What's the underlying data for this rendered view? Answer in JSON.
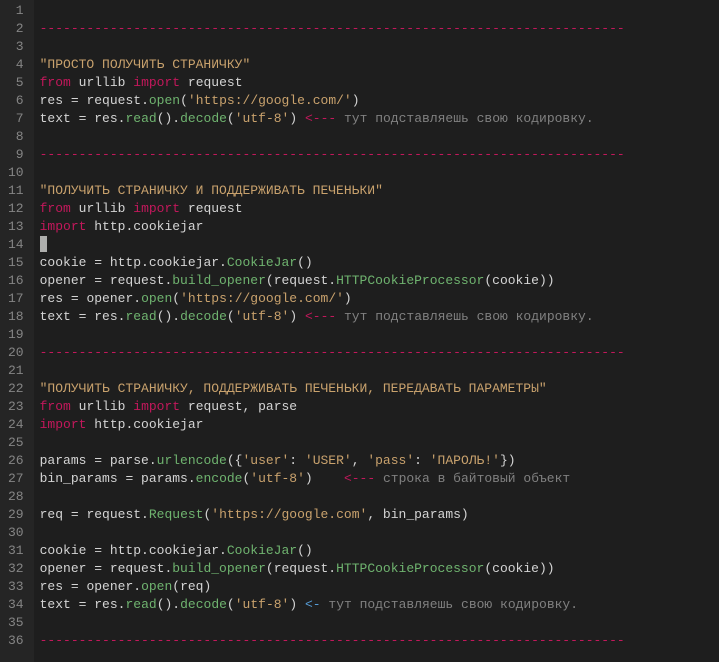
{
  "lines": [
    {
      "n": 1,
      "tokens": []
    },
    {
      "n": 2,
      "tokens": [
        {
          "c": "tok-comment-dash",
          "t": "---------------------------------------------------------------------------"
        }
      ]
    },
    {
      "n": 3,
      "tokens": []
    },
    {
      "n": 4,
      "tokens": [
        {
          "c": "tok-string",
          "t": "\"ПРОСТО ПОЛУЧИТЬ СТРАНИЧКУ\""
        }
      ]
    },
    {
      "n": 5,
      "tokens": [
        {
          "c": "tok-keyword",
          "t": "from"
        },
        {
          "c": "",
          "t": " "
        },
        {
          "c": "tok-module",
          "t": "urllib"
        },
        {
          "c": "",
          "t": " "
        },
        {
          "c": "tok-keyword",
          "t": "import"
        },
        {
          "c": "",
          "t": " "
        },
        {
          "c": "tok-module",
          "t": "request"
        }
      ]
    },
    {
      "n": 6,
      "tokens": [
        {
          "c": "tok-var",
          "t": "res "
        },
        {
          "c": "tok-op",
          "t": "="
        },
        {
          "c": "tok-var",
          "t": " request"
        },
        {
          "c": "tok-op",
          "t": "."
        },
        {
          "c": "tok-func",
          "t": "open"
        },
        {
          "c": "tok-paren",
          "t": "("
        },
        {
          "c": "tok-string",
          "t": "'https://google.com/'"
        },
        {
          "c": "tok-paren",
          "t": ")"
        }
      ]
    },
    {
      "n": 7,
      "tokens": [
        {
          "c": "tok-var",
          "t": "text "
        },
        {
          "c": "tok-op",
          "t": "="
        },
        {
          "c": "tok-var",
          "t": " res"
        },
        {
          "c": "tok-op",
          "t": "."
        },
        {
          "c": "tok-func",
          "t": "read"
        },
        {
          "c": "tok-paren",
          "t": "()"
        },
        {
          "c": "tok-op",
          "t": "."
        },
        {
          "c": "tok-func",
          "t": "decode"
        },
        {
          "c": "tok-paren",
          "t": "("
        },
        {
          "c": "tok-string",
          "t": "'utf-8'"
        },
        {
          "c": "tok-paren",
          "t": ")"
        },
        {
          "c": "",
          "t": " "
        },
        {
          "c": "tok-arrow",
          "t": "<---"
        },
        {
          "c": "",
          "t": " "
        },
        {
          "c": "tok-rucomment",
          "t": "тут подставляешь свою кодировку."
        }
      ]
    },
    {
      "n": 8,
      "tokens": []
    },
    {
      "n": 9,
      "tokens": [
        {
          "c": "tok-comment-dash",
          "t": "---------------------------------------------------------------------------"
        }
      ]
    },
    {
      "n": 10,
      "tokens": []
    },
    {
      "n": 11,
      "tokens": [
        {
          "c": "tok-string",
          "t": "\"ПОЛУЧИТЬ СТРАНИЧКУ И ПОДДЕРЖИВАТЬ ПЕЧЕНЬКИ\""
        }
      ]
    },
    {
      "n": 12,
      "tokens": [
        {
          "c": "tok-keyword",
          "t": "from"
        },
        {
          "c": "",
          "t": " "
        },
        {
          "c": "tok-module",
          "t": "urllib"
        },
        {
          "c": "",
          "t": " "
        },
        {
          "c": "tok-keyword",
          "t": "import"
        },
        {
          "c": "",
          "t": " "
        },
        {
          "c": "tok-module",
          "t": "request"
        }
      ]
    },
    {
      "n": 13,
      "tokens": [
        {
          "c": "tok-keyword",
          "t": "import"
        },
        {
          "c": "",
          "t": " "
        },
        {
          "c": "tok-module",
          "t": "http.cookiejar"
        }
      ]
    },
    {
      "n": 14,
      "tokens": [
        {
          "c": "tok-cursor",
          "t": " "
        }
      ]
    },
    {
      "n": 15,
      "tokens": [
        {
          "c": "tok-var",
          "t": "cookie "
        },
        {
          "c": "tok-op",
          "t": "="
        },
        {
          "c": "tok-var",
          "t": " http.cookiejar."
        },
        {
          "c": "tok-func",
          "t": "CookieJar"
        },
        {
          "c": "tok-paren",
          "t": "()"
        }
      ]
    },
    {
      "n": 16,
      "tokens": [
        {
          "c": "tok-var",
          "t": "opener "
        },
        {
          "c": "tok-op",
          "t": "="
        },
        {
          "c": "tok-var",
          "t": " request."
        },
        {
          "c": "tok-func",
          "t": "build_opener"
        },
        {
          "c": "tok-paren",
          "t": "("
        },
        {
          "c": "tok-var",
          "t": "request."
        },
        {
          "c": "tok-func",
          "t": "HTTPCookieProcessor"
        },
        {
          "c": "tok-paren",
          "t": "("
        },
        {
          "c": "tok-var",
          "t": "cookie"
        },
        {
          "c": "tok-paren",
          "t": "))"
        }
      ]
    },
    {
      "n": 17,
      "tokens": [
        {
          "c": "tok-var",
          "t": "res "
        },
        {
          "c": "tok-op",
          "t": "="
        },
        {
          "c": "tok-var",
          "t": " opener"
        },
        {
          "c": "tok-op",
          "t": "."
        },
        {
          "c": "tok-func",
          "t": "open"
        },
        {
          "c": "tok-paren",
          "t": "("
        },
        {
          "c": "tok-string",
          "t": "'https://google.com/'"
        },
        {
          "c": "tok-paren",
          "t": ")"
        }
      ]
    },
    {
      "n": 18,
      "tokens": [
        {
          "c": "tok-var",
          "t": "text "
        },
        {
          "c": "tok-op",
          "t": "="
        },
        {
          "c": "tok-var",
          "t": " res"
        },
        {
          "c": "tok-op",
          "t": "."
        },
        {
          "c": "tok-func",
          "t": "read"
        },
        {
          "c": "tok-paren",
          "t": "()"
        },
        {
          "c": "tok-op",
          "t": "."
        },
        {
          "c": "tok-func",
          "t": "decode"
        },
        {
          "c": "tok-paren",
          "t": "("
        },
        {
          "c": "tok-string",
          "t": "'utf-8'"
        },
        {
          "c": "tok-paren",
          "t": ")"
        },
        {
          "c": "",
          "t": " "
        },
        {
          "c": "tok-arrow",
          "t": "<---"
        },
        {
          "c": "",
          "t": " "
        },
        {
          "c": "tok-rucomment",
          "t": "тут подставляешь свою кодировку."
        }
      ]
    },
    {
      "n": 19,
      "tokens": []
    },
    {
      "n": 20,
      "tokens": [
        {
          "c": "tok-comment-dash",
          "t": "---------------------------------------------------------------------------"
        }
      ]
    },
    {
      "n": 21,
      "tokens": []
    },
    {
      "n": 22,
      "tokens": [
        {
          "c": "tok-string",
          "t": "\"ПОЛУЧИТЬ СТРАНИЧКУ, ПОДДЕРЖИВАТЬ ПЕЧЕНЬКИ, ПЕРЕДАВАТЬ ПАРАМЕТРЫ\""
        }
      ]
    },
    {
      "n": 23,
      "tokens": [
        {
          "c": "tok-keyword",
          "t": "from"
        },
        {
          "c": "",
          "t": " "
        },
        {
          "c": "tok-module",
          "t": "urllib"
        },
        {
          "c": "",
          "t": " "
        },
        {
          "c": "tok-keyword",
          "t": "import"
        },
        {
          "c": "",
          "t": " "
        },
        {
          "c": "tok-module",
          "t": "request, parse"
        }
      ]
    },
    {
      "n": 24,
      "tokens": [
        {
          "c": "tok-keyword",
          "t": "import"
        },
        {
          "c": "",
          "t": " "
        },
        {
          "c": "tok-module",
          "t": "http.cookiejar"
        }
      ]
    },
    {
      "n": 25,
      "tokens": []
    },
    {
      "n": 26,
      "tokens": [
        {
          "c": "tok-var",
          "t": "params "
        },
        {
          "c": "tok-op",
          "t": "="
        },
        {
          "c": "tok-var",
          "t": " parse."
        },
        {
          "c": "tok-func",
          "t": "urlencode"
        },
        {
          "c": "tok-paren",
          "t": "({"
        },
        {
          "c": "tok-string",
          "t": "'user'"
        },
        {
          "c": "tok-paren",
          "t": ": "
        },
        {
          "c": "tok-string",
          "t": "'USER'"
        },
        {
          "c": "tok-paren",
          "t": ", "
        },
        {
          "c": "tok-string",
          "t": "'pass'"
        },
        {
          "c": "tok-paren",
          "t": ": "
        },
        {
          "c": "tok-string",
          "t": "'ПАРОЛЬ!'"
        },
        {
          "c": "tok-paren",
          "t": "})"
        }
      ]
    },
    {
      "n": 27,
      "tokens": [
        {
          "c": "tok-var",
          "t": "bin_params "
        },
        {
          "c": "tok-op",
          "t": "="
        },
        {
          "c": "tok-var",
          "t": " params."
        },
        {
          "c": "tok-func",
          "t": "encode"
        },
        {
          "c": "tok-paren",
          "t": "("
        },
        {
          "c": "tok-string",
          "t": "'utf-8'"
        },
        {
          "c": "tok-paren",
          "t": ")"
        },
        {
          "c": "",
          "t": "    "
        },
        {
          "c": "tok-arrow",
          "t": "<---"
        },
        {
          "c": "",
          "t": " "
        },
        {
          "c": "tok-rucomment",
          "t": "строка в байтовый объект"
        }
      ]
    },
    {
      "n": 28,
      "tokens": []
    },
    {
      "n": 29,
      "tokens": [
        {
          "c": "tok-var",
          "t": "req "
        },
        {
          "c": "tok-op",
          "t": "="
        },
        {
          "c": "tok-var",
          "t": " request."
        },
        {
          "c": "tok-func",
          "t": "Request"
        },
        {
          "c": "tok-paren",
          "t": "("
        },
        {
          "c": "tok-string",
          "t": "'https://google.com'"
        },
        {
          "c": "tok-paren",
          "t": ", bin_params)"
        }
      ]
    },
    {
      "n": 30,
      "tokens": []
    },
    {
      "n": 31,
      "tokens": [
        {
          "c": "tok-var",
          "t": "cookie "
        },
        {
          "c": "tok-op",
          "t": "="
        },
        {
          "c": "tok-var",
          "t": " http.cookiejar."
        },
        {
          "c": "tok-func",
          "t": "CookieJar"
        },
        {
          "c": "tok-paren",
          "t": "()"
        }
      ]
    },
    {
      "n": 32,
      "tokens": [
        {
          "c": "tok-var",
          "t": "opener "
        },
        {
          "c": "tok-op",
          "t": "="
        },
        {
          "c": "tok-var",
          "t": " request."
        },
        {
          "c": "tok-func",
          "t": "build_opener"
        },
        {
          "c": "tok-paren",
          "t": "("
        },
        {
          "c": "tok-var",
          "t": "request."
        },
        {
          "c": "tok-func",
          "t": "HTTPCookieProcessor"
        },
        {
          "c": "tok-paren",
          "t": "("
        },
        {
          "c": "tok-var",
          "t": "cookie"
        },
        {
          "c": "tok-paren",
          "t": "))"
        }
      ]
    },
    {
      "n": 33,
      "tokens": [
        {
          "c": "tok-var",
          "t": "res "
        },
        {
          "c": "tok-op",
          "t": "="
        },
        {
          "c": "tok-var",
          "t": " opener"
        },
        {
          "c": "tok-op",
          "t": "."
        },
        {
          "c": "tok-func",
          "t": "open"
        },
        {
          "c": "tok-paren",
          "t": "(req)"
        }
      ]
    },
    {
      "n": 34,
      "tokens": [
        {
          "c": "tok-var",
          "t": "text "
        },
        {
          "c": "tok-op",
          "t": "="
        },
        {
          "c": "tok-var",
          "t": " res"
        },
        {
          "c": "tok-op",
          "t": "."
        },
        {
          "c": "tok-func",
          "t": "read"
        },
        {
          "c": "tok-paren",
          "t": "()"
        },
        {
          "c": "tok-op",
          "t": "."
        },
        {
          "c": "tok-func",
          "t": "decode"
        },
        {
          "c": "tok-paren",
          "t": "("
        },
        {
          "c": "tok-string",
          "t": "'utf-8'"
        },
        {
          "c": "tok-paren",
          "t": ")"
        },
        {
          "c": "",
          "t": " "
        },
        {
          "c": "tok-ruarrow",
          "t": "<-"
        },
        {
          "c": "",
          "t": " "
        },
        {
          "c": "tok-rucomment",
          "t": "тут подставляешь свою кодировку."
        }
      ]
    },
    {
      "n": 35,
      "tokens": []
    },
    {
      "n": 36,
      "tokens": [
        {
          "c": "tok-comment-dash",
          "t": "---------------------------------------------------------------------------"
        }
      ]
    }
  ]
}
